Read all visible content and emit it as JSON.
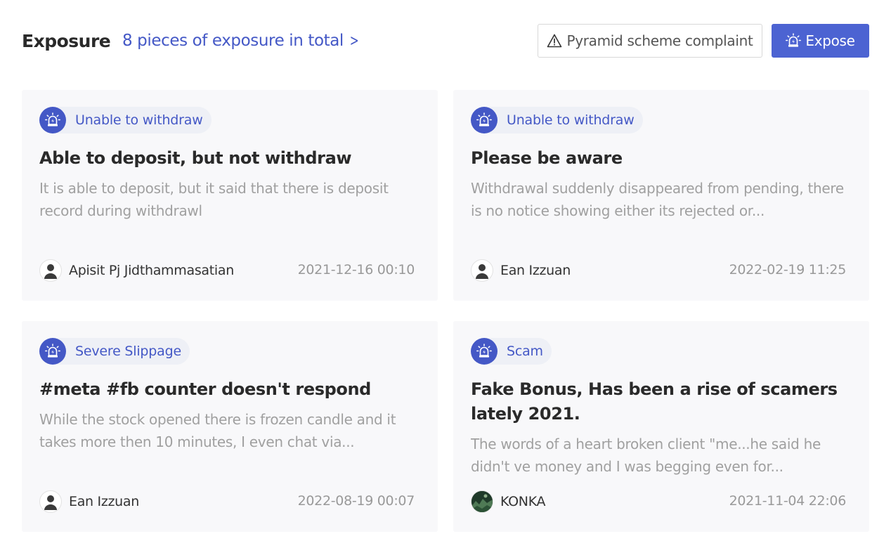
{
  "header": {
    "title": "Exposure",
    "total_link": "8 pieces of exposure in total",
    "complaint_button": "Pyramid scheme complaint",
    "expose_button": "Expose"
  },
  "cards": [
    {
      "tag": "Unable to withdraw",
      "title": "Able to deposit, but not withdraw",
      "description": "It is able to deposit, but it said that there is deposit record during withdrawl",
      "author": "Apisit Pj Jidthammasatian",
      "date": "2021-12-16 00:10"
    },
    {
      "tag": "Unable to withdraw",
      "title": "Please be aware",
      "description": "Withdrawal suddenly disappeared from pending, there is no notice showing either its rejected or...",
      "author": "Ean Izzuan",
      "date": "2022-02-19 11:25"
    },
    {
      "tag": "Severe Slippage",
      "title": "#meta #fb counter doesn't respond",
      "description": "While the stock opened there is frozen candle and it takes more then 10 minutes, I even chat via...",
      "author": "Ean Izzuan",
      "date": "2022-08-19 00:07"
    },
    {
      "tag": "Scam",
      "title": "Fake Bonus, Has been a rise of scamers lately 2021.",
      "description": "The words of a heart broken client \"me...he said he didn't ve money and I was begging even for...",
      "author": "KONKA",
      "date": "2021-11-04 22:06"
    }
  ],
  "colors": {
    "accent": "#4458c6",
    "button_primary": "#4c63d2",
    "card_background": "#f8f8fa",
    "muted_text": "#a0a0a0"
  },
  "icons": {
    "header_link": "chevron-right-icon",
    "complaint": "warning-triangle-icon",
    "expose": "alarm-siren-icon",
    "tag": "alarm-siren-icon",
    "avatar_default": "user-silhouette-icon"
  }
}
